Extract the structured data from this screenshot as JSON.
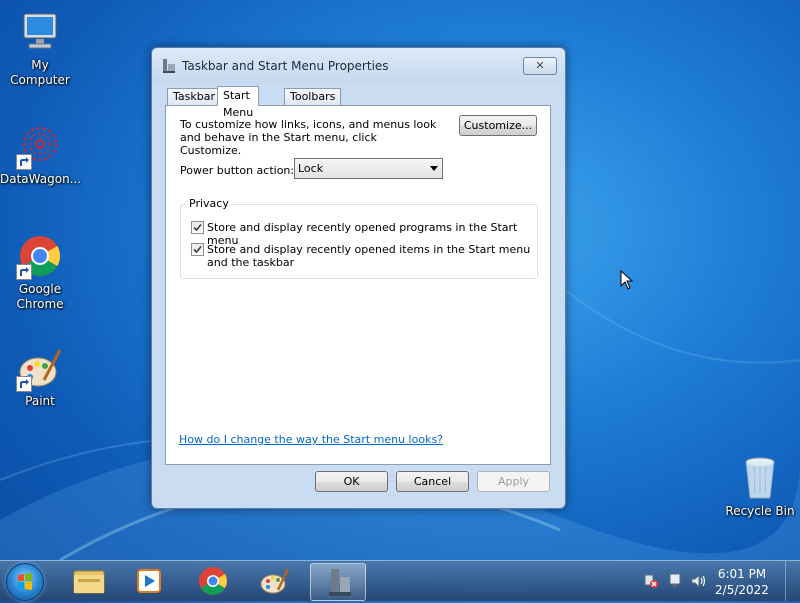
{
  "desktop": {
    "icons": [
      {
        "label": "My Computer"
      },
      {
        "label": "DataWagon..."
      },
      {
        "label": "Google Chrome"
      },
      {
        "label": "Paint"
      },
      {
        "label": "Recycle Bin"
      }
    ]
  },
  "dialog": {
    "title": "Taskbar and Start Menu Properties",
    "close_label": "✕",
    "tabs": [
      {
        "label": "Taskbar"
      },
      {
        "label": "Start Menu",
        "active": true
      },
      {
        "label": "Toolbars"
      }
    ],
    "intro_text": "To customize how links, icons, and menus look and behave in the Start menu, click Customize.",
    "customize_label": "Customize...",
    "power_label": "Power button action:",
    "power_value": "Lock",
    "privacy": {
      "title": "Privacy",
      "items": [
        {
          "label": "Store and display recently opened programs in the Start menu",
          "checked": true
        },
        {
          "label": "Store and display recently opened items in the Start menu and the taskbar",
          "checked": true
        }
      ]
    },
    "help_link": "How do I change the way the Start menu looks?",
    "buttons": {
      "ok": "OK",
      "cancel": "Cancel",
      "apply": "Apply"
    }
  },
  "taskbar": {
    "time": "6:01 PM",
    "date": "2/5/2022",
    "pinned": [
      "explorer-icon",
      "media-player-icon",
      "chrome-icon",
      "paint-icon",
      "taskbar-properties-icon"
    ]
  },
  "colors": {
    "desktop_blue": "#1f7fd8",
    "link": "#0066cc"
  }
}
